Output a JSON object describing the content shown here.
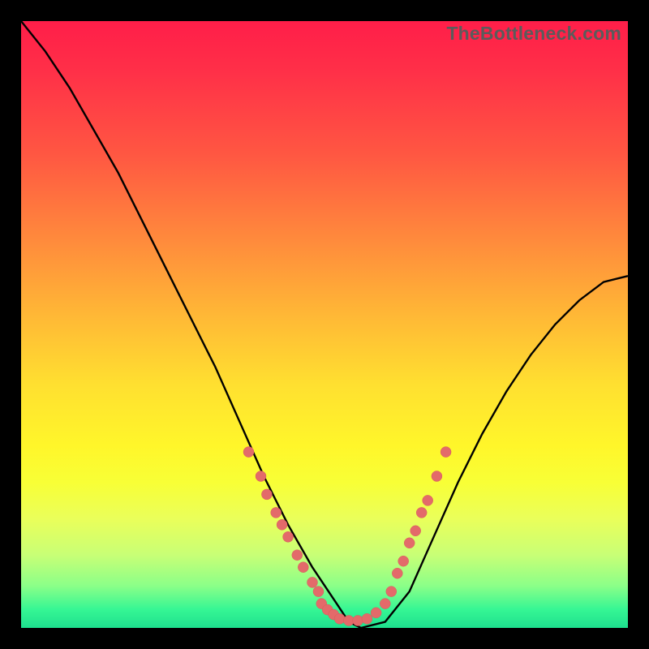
{
  "watermark": "TheBottleneck.com",
  "colors": {
    "frame": "#000000",
    "curve": "#000000",
    "dot_fill": "#e36a6a",
    "dot_stroke": "#d95a5a"
  },
  "chart_data": {
    "type": "line",
    "title": "",
    "xlabel": "",
    "ylabel": "",
    "xlim": [
      0,
      100
    ],
    "ylim": [
      0,
      100
    ],
    "series": [
      {
        "name": "bottleneck-curve",
        "x": [
          0,
          4,
          8,
          12,
          16,
          20,
          24,
          28,
          32,
          36,
          40,
          44,
          48,
          52,
          54,
          56,
          60,
          64,
          68,
          72,
          76,
          80,
          84,
          88,
          92,
          96,
          100
        ],
        "y": [
          100,
          95,
          89,
          82,
          75,
          67,
          59,
          51,
          43,
          34,
          25,
          17,
          10,
          4,
          1,
          0,
          1,
          6,
          15,
          24,
          32,
          39,
          45,
          50,
          54,
          57,
          58
        ]
      }
    ],
    "scatter": [
      {
        "name": "left-cluster",
        "points": [
          {
            "x": 37.5,
            "y": 29
          },
          {
            "x": 39.5,
            "y": 25
          },
          {
            "x": 40.5,
            "y": 22
          },
          {
            "x": 42.0,
            "y": 19
          },
          {
            "x": 43.0,
            "y": 17
          },
          {
            "x": 44.0,
            "y": 15
          },
          {
            "x": 45.5,
            "y": 12
          },
          {
            "x": 46.5,
            "y": 10
          },
          {
            "x": 48.0,
            "y": 7.5
          },
          {
            "x": 49.0,
            "y": 6
          }
        ]
      },
      {
        "name": "bottom-cluster",
        "points": [
          {
            "x": 49.5,
            "y": 4
          },
          {
            "x": 50.5,
            "y": 3
          },
          {
            "x": 51.5,
            "y": 2.2
          },
          {
            "x": 52.5,
            "y": 1.5
          },
          {
            "x": 54.0,
            "y": 1.2
          },
          {
            "x": 55.5,
            "y": 1.2
          },
          {
            "x": 57.0,
            "y": 1.5
          },
          {
            "x": 58.5,
            "y": 2.5
          }
        ]
      },
      {
        "name": "right-cluster",
        "points": [
          {
            "x": 60.0,
            "y": 4
          },
          {
            "x": 61.0,
            "y": 6
          },
          {
            "x": 62.0,
            "y": 9
          },
          {
            "x": 63.0,
            "y": 11
          },
          {
            "x": 64.0,
            "y": 14
          },
          {
            "x": 65.0,
            "y": 16
          },
          {
            "x": 66.0,
            "y": 19
          },
          {
            "x": 67.0,
            "y": 21
          },
          {
            "x": 68.5,
            "y": 25
          },
          {
            "x": 70.0,
            "y": 29
          }
        ]
      }
    ]
  }
}
